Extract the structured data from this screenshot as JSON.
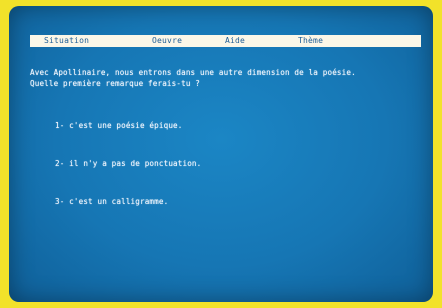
{
  "menu": {
    "items": [
      "Situation",
      "Oeuvre",
      "Aide",
      "Thème"
    ]
  },
  "question": {
    "line1": "Avec Apollinaire, nous entrons dans une autre dimension de la poésie.",
    "line2": "Quelle première remarque ferais-tu ?"
  },
  "answers": [
    {
      "text": "1- c'est une poésie épique."
    },
    {
      "text": "2- il n'y a pas de ponctuation."
    },
    {
      "text": "3- c'est un calligramme."
    }
  ],
  "colors": {
    "frame": "#f2e22a",
    "screen": "#1676b4",
    "menu_bar": "#fbf7e8",
    "menu_text": "#1f5e97",
    "text": "#f3f7ff"
  }
}
